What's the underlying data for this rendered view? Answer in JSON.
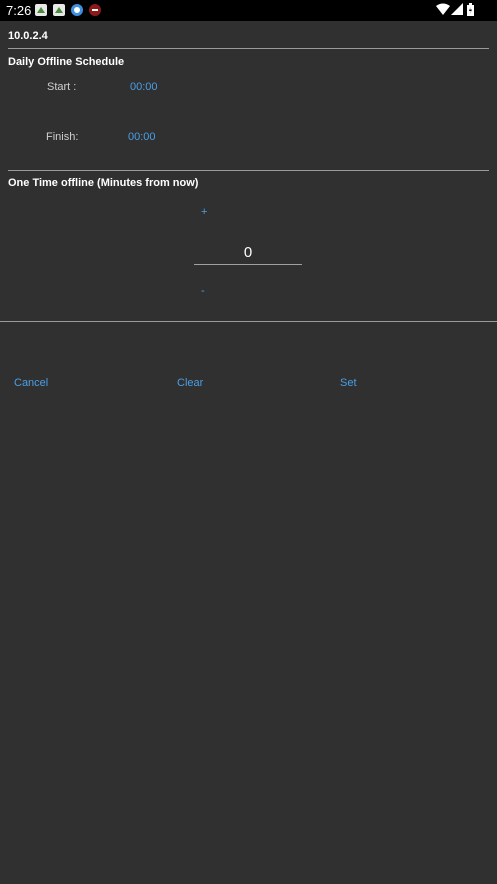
{
  "status_bar": {
    "time": "7:26",
    "left_icons": [
      "app-icon-1",
      "app-icon-2",
      "app-icon-3",
      "app-icon-4"
    ],
    "right_icons": [
      "wifi-icon",
      "signal-icon",
      "battery-icon"
    ]
  },
  "header": {
    "host": "10.0.2.4"
  },
  "daily_schedule": {
    "title": "Daily Offline Schedule",
    "start_label": "Start :",
    "start_value": "00:00",
    "finish_label": "Finish:",
    "finish_value": "00:00"
  },
  "one_time": {
    "title": "One Time offline (Minutes from now)",
    "plus_label": "+",
    "value": "0",
    "minus_label": "-"
  },
  "actions": {
    "cancel_label": "Cancel",
    "clear_label": "Clear",
    "set_label": "Set"
  },
  "colors": {
    "background": "#303030",
    "accent": "#4a9fe6",
    "statusbar": "#000000"
  }
}
